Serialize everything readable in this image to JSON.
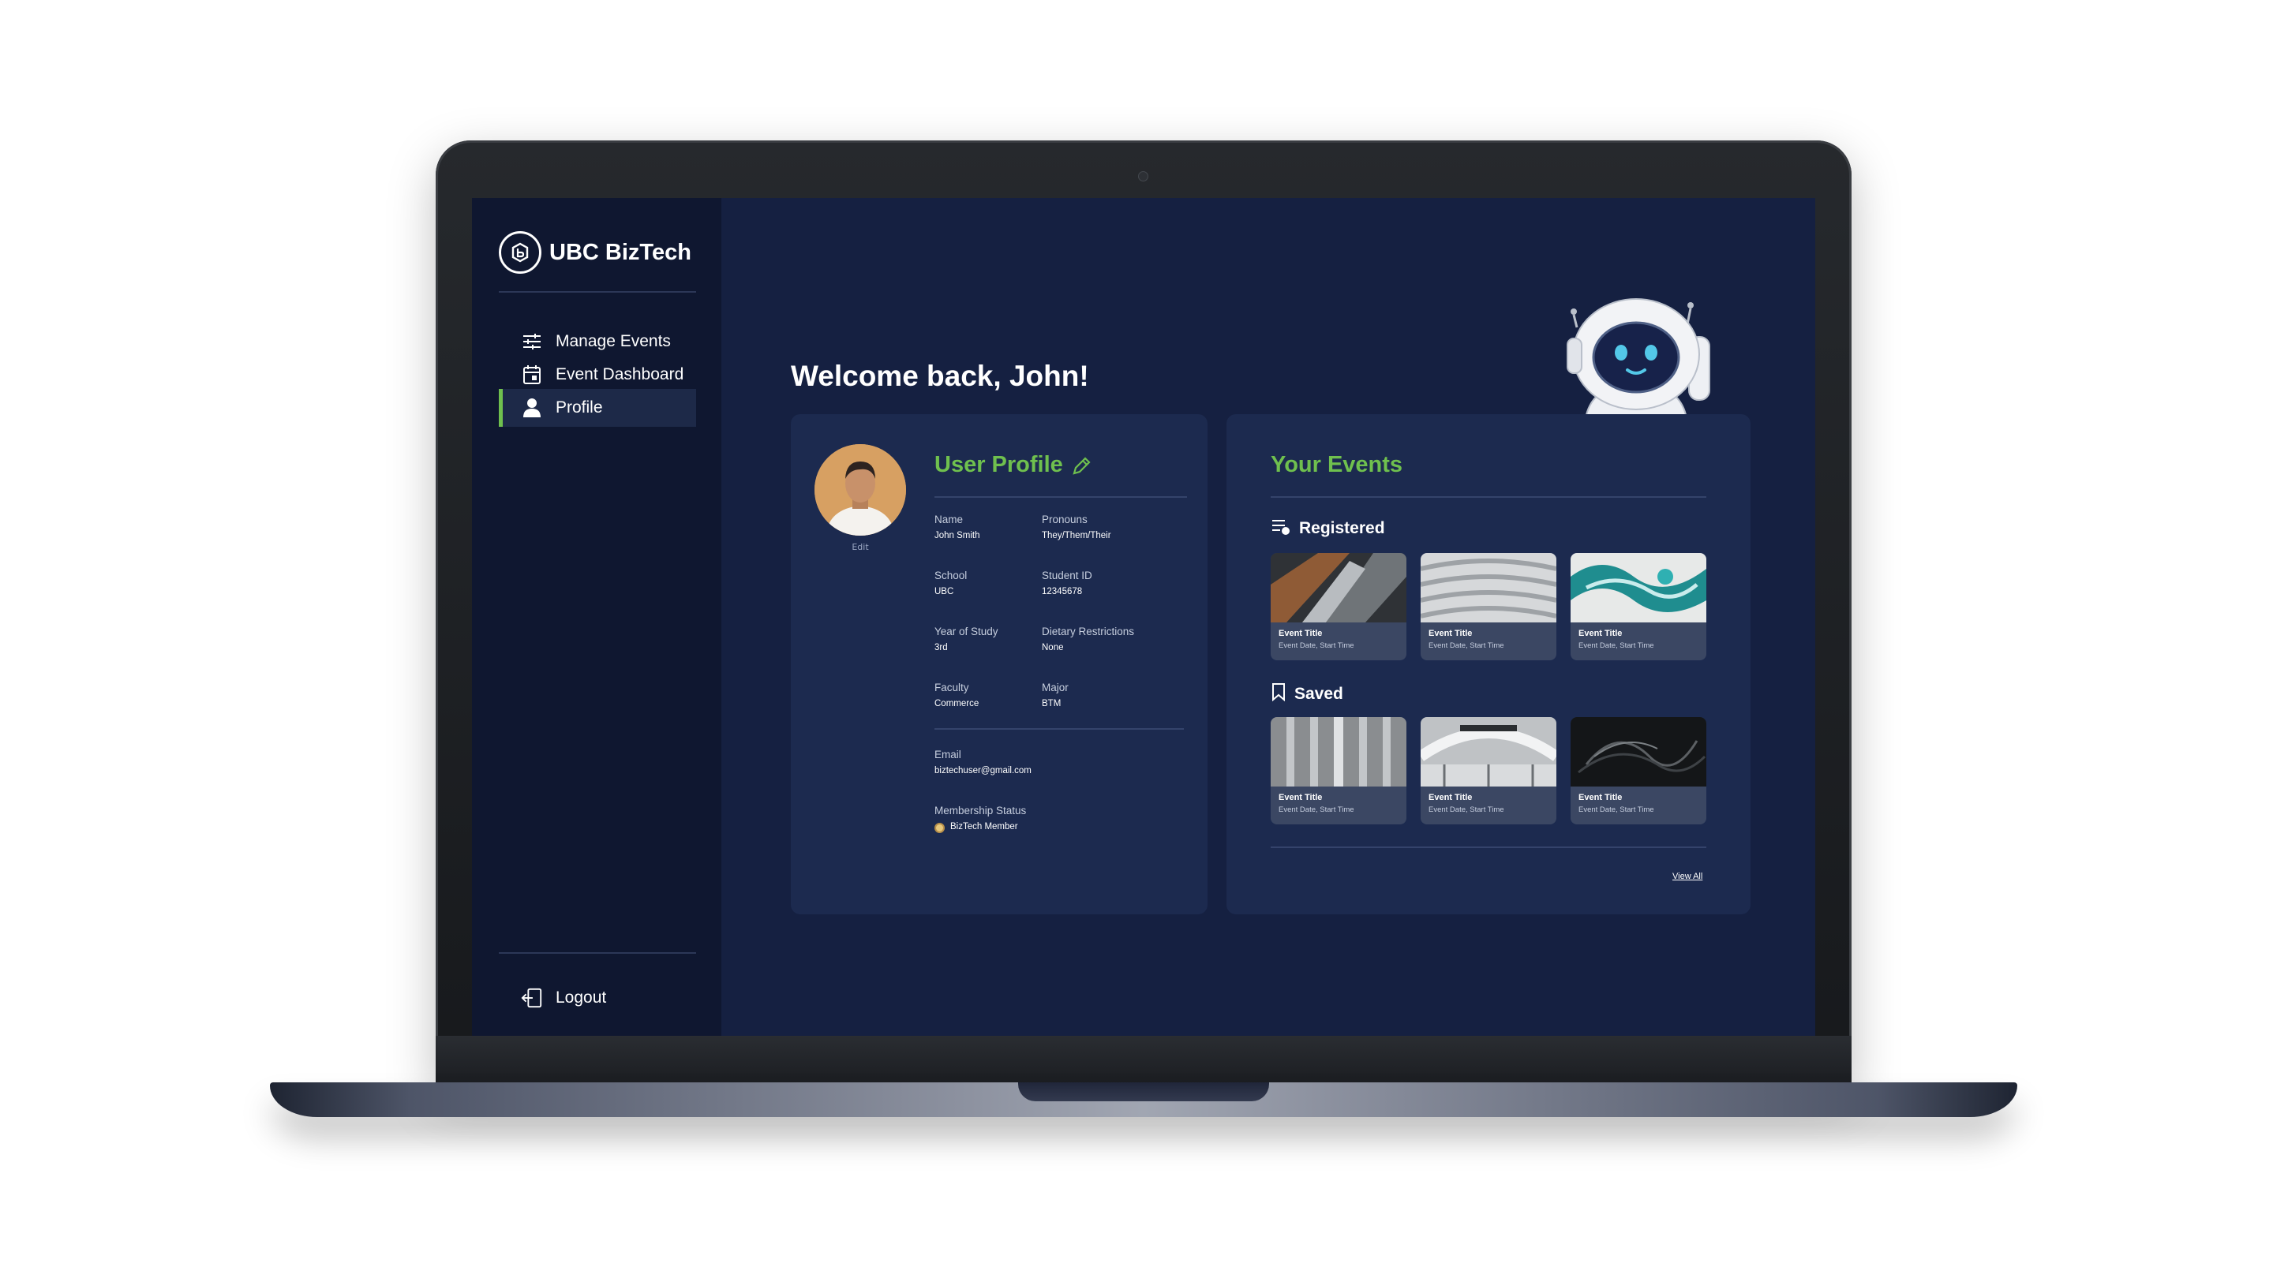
{
  "brand": {
    "name": "UBC BizTech"
  },
  "sidebar": {
    "items": [
      {
        "label": "Manage Events",
        "icon": "sliders-icon"
      },
      {
        "label": "Event Dashboard",
        "icon": "calendar-icon"
      },
      {
        "label": "Profile",
        "icon": "user-icon",
        "active": true
      }
    ],
    "logout_label": "Logout"
  },
  "main": {
    "welcome": "Welcome back, John!"
  },
  "profile": {
    "title": "User Profile",
    "avatar_caption": "Edit",
    "fields": {
      "name": {
        "label": "Name",
        "value": "John Smith"
      },
      "pronouns": {
        "label": "Pronouns",
        "value": "They/Them/Their"
      },
      "school": {
        "label": "School",
        "value": "UBC"
      },
      "student_id": {
        "label": "Student ID",
        "value": "12345678"
      },
      "year": {
        "label": "Year of Study",
        "value": "3rd"
      },
      "dietary": {
        "label": "Dietary Restrictions",
        "value": "None"
      },
      "faculty": {
        "label": "Faculty",
        "value": "Commerce"
      },
      "major": {
        "label": "Major",
        "value": "BTM"
      },
      "email": {
        "label": "Email",
        "value": "biztechuser@gmail.com"
      },
      "membership": {
        "label": "Membership Status",
        "value": "BizTech Member"
      }
    }
  },
  "events": {
    "title": "Your Events",
    "registered_label": "Registered",
    "saved_label": "Saved",
    "registered": [
      {
        "title": "Event Title",
        "subtitle": "Event Date, Start Time"
      },
      {
        "title": "Event Title",
        "subtitle": "Event Date, Start Time"
      },
      {
        "title": "Event Title",
        "subtitle": "Event Date, Start Time"
      }
    ],
    "saved": [
      {
        "title": "Event Title",
        "subtitle": "Event Date, Start Time"
      },
      {
        "title": "Event Title",
        "subtitle": "Event Date, Start Time"
      },
      {
        "title": "Event Title",
        "subtitle": "Event Date, Start Time"
      }
    ],
    "view_all": "View All"
  },
  "colors": {
    "accent": "#6fc04e",
    "background": "#152041",
    "sidebar": "#0f1730",
    "card": "#1c2a4f"
  }
}
